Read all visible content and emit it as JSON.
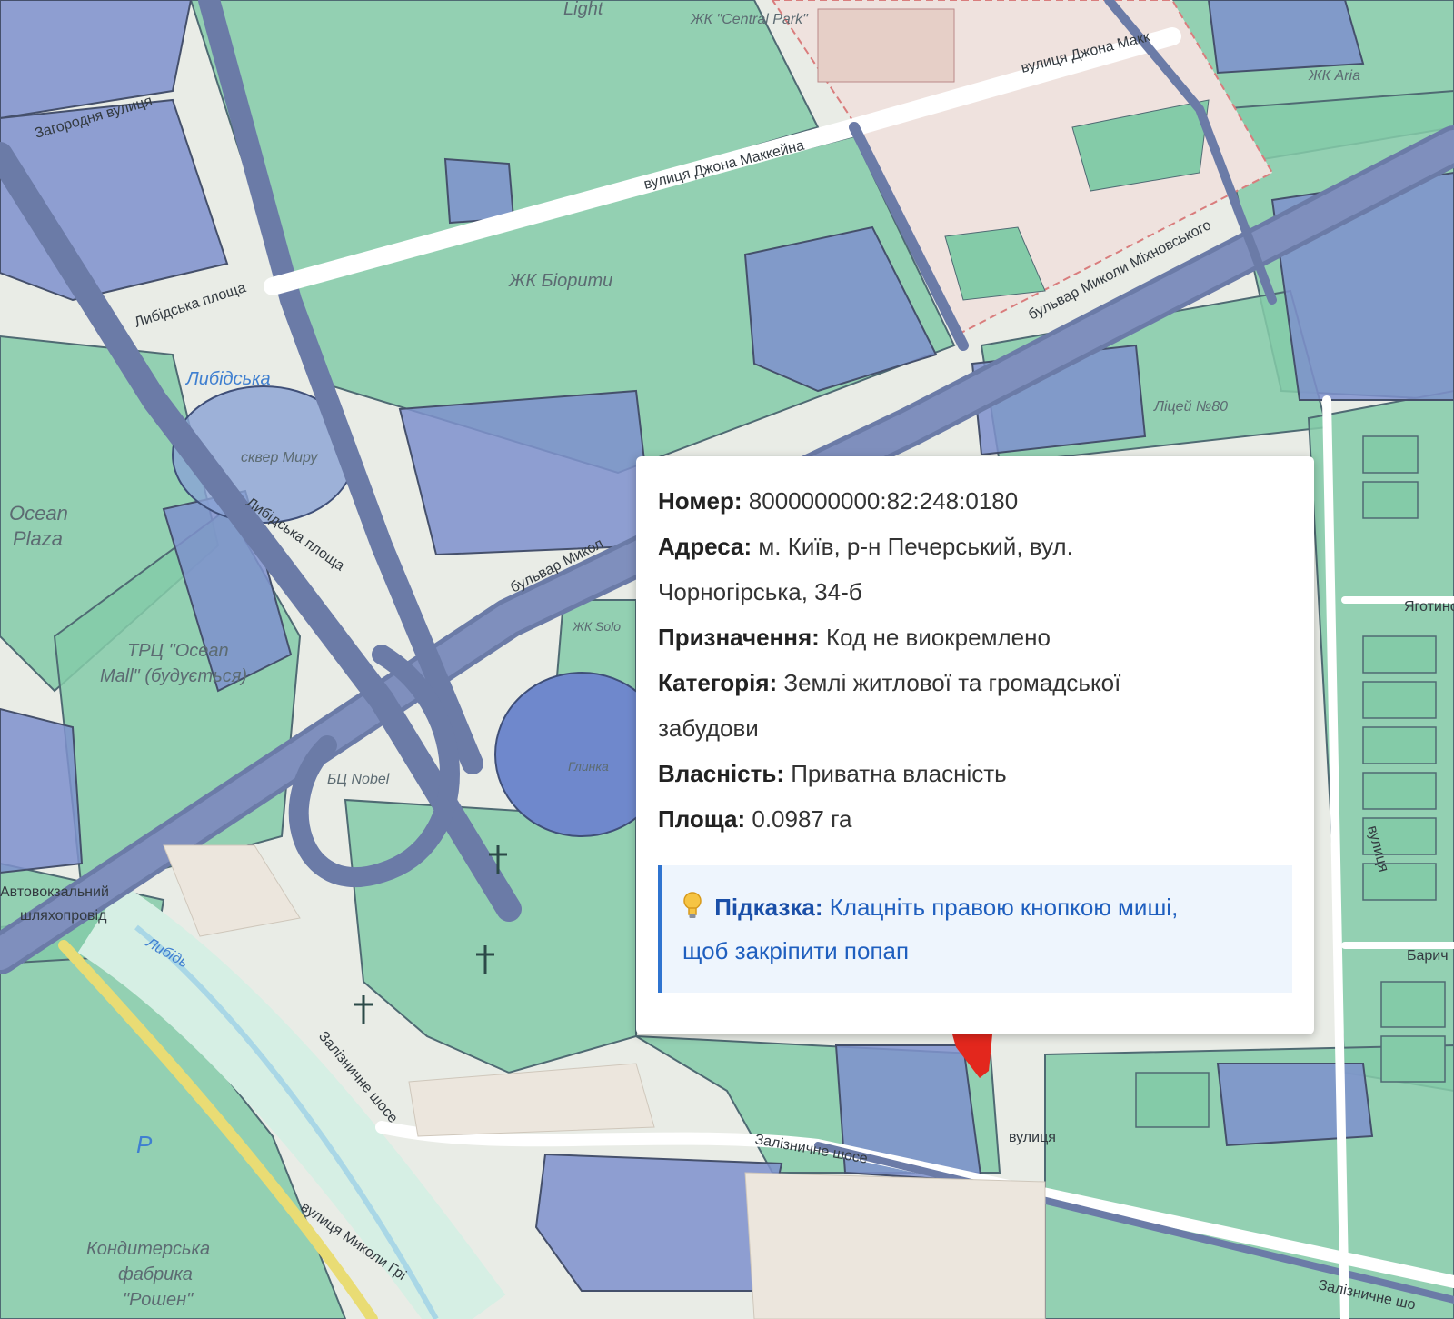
{
  "map": {
    "streets": {
      "john_mccain_upper": "вулиця Джона Макк",
      "john_mccain": "вулиця Джона Маккейна",
      "mikhnovskoho_east": "бульвар Миколи Міхновського",
      "mikhnovskoho_west": "бульвар Микол",
      "zahorodnia": "Загородня вулиця",
      "lybidska_square": "Либідська площа",
      "lybidska_street": "Либідська площа",
      "zaliznychne_1": "Залізничне шосе",
      "zaliznychne_2": "Залізничне шосе",
      "zaliznychne_3": "Залізничне шо",
      "hrinchenka": "вулиця Миколи Грі",
      "yahotynska": "Яготинсь",
      "ulytsia": "вулиця",
      "bariczna": "Барич",
      "small_vert": "вулиця"
    },
    "places": {
      "light": "Light",
      "central_park": "ЖК \"Central Park\"",
      "zhk_aria": "ЖК Aria",
      "zhk_biority": "ЖК Біорити",
      "lybidska_metro": "Либідська",
      "skver_myru": "сквер Миру",
      "ocean_plaza_1": "Ocean",
      "ocean_plaza_2": "Plaza",
      "trts_1": "ТРЦ \"Ocean",
      "trts_2": "Mall\" (будується)",
      "zhk_solo": "ЖК Solo",
      "bts_nobel": "БЦ Nobel",
      "hlynka": "Глинка",
      "lytsei": "Ліцей №80",
      "avtovokzal_1": "Автовокзальний",
      "avtovokzal_2": "шляхопровід",
      "lybid_river": "Либідь",
      "roshen_1": "Кондитерська",
      "roshen_2": "фабрика",
      "roshen_3": "\"Рошен\"",
      "parking": "P"
    }
  },
  "popup": {
    "number_label": "Номер:",
    "number_value": "8000000000:82:248:0180",
    "address_label": "Адреса:",
    "address_value_1": "м. Київ, р-н Печерський, вул.",
    "address_value_2": "Чорногірська, 34-б",
    "purpose_label": "Призначення:",
    "purpose_value": "Код не виокремлено",
    "category_label": "Категорія:",
    "category_value_1": "Землі житлової та громадської",
    "category_value_2": "забудови",
    "ownership_label": "Власність:",
    "ownership_value": "Приватна власність",
    "area_label": "Площа:",
    "area_value": "0.0987 га",
    "hint_label": "Підказка:",
    "hint_text_1": "Клацніть правою кнопкою миші,",
    "hint_text_2": "щоб закріпити попап"
  },
  "colors": {
    "parcel_green": "#7fcaa6",
    "parcel_blue": "#7f92cc",
    "road": "#6f7ea8",
    "hint_border": "#2f74d0",
    "marker": "#e3271d"
  }
}
